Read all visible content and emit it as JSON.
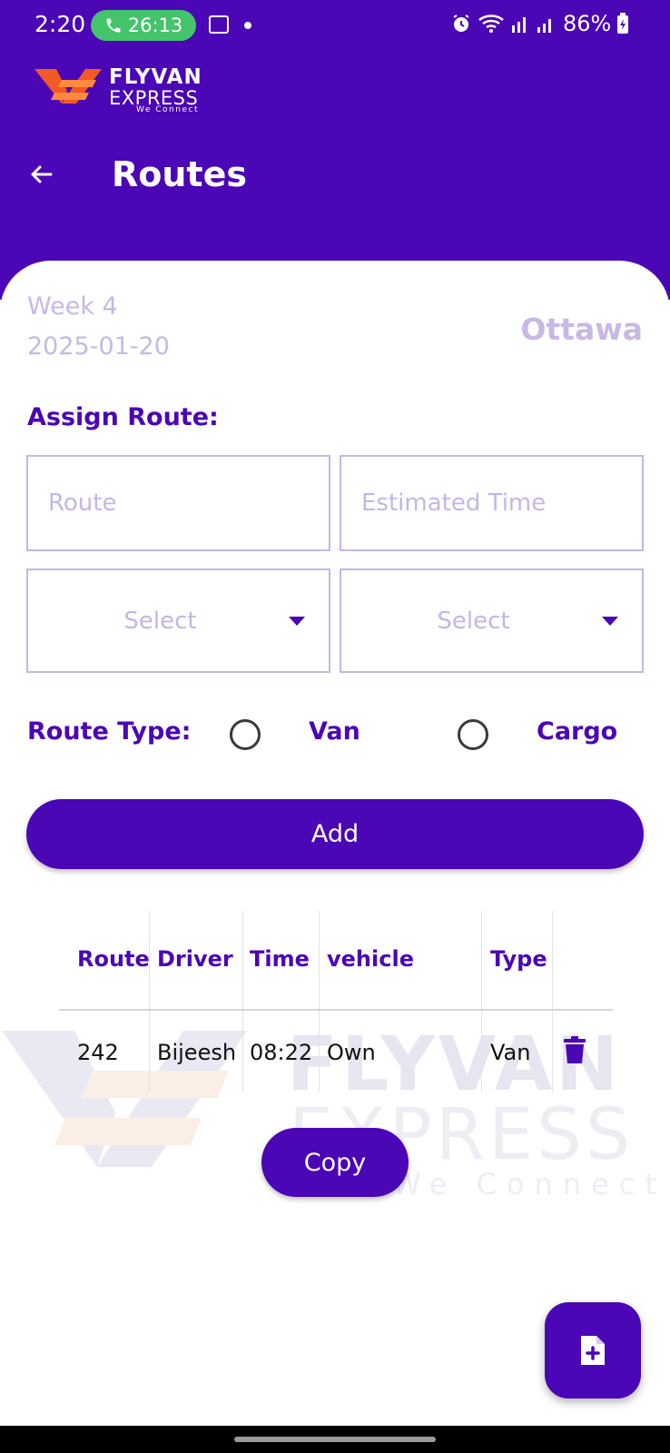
{
  "colors": {
    "primary": "#4b06b5",
    "muted_lavender": "#c8b8e4",
    "call_green": "#45c46b",
    "logo_orange": "#f15a24"
  },
  "status_bar": {
    "time": "2:20",
    "call_timer": "26:13",
    "battery": "86%",
    "icons": [
      "phone-icon",
      "gallery-icon",
      "notification-dot",
      "alarm-icon",
      "wifi-icon",
      "signal-icon",
      "signal-icon",
      "battery-charging-icon"
    ]
  },
  "logo": {
    "title": "FLYVAN",
    "subtitle": "EXPRESS",
    "tagline": "We Connect"
  },
  "header": {
    "title": "Routes",
    "back_icon": "arrow-left-icon"
  },
  "info": {
    "week": "Week 4",
    "date": "2025-01-20",
    "city": "Ottawa"
  },
  "form": {
    "assign_label": "Assign Route:",
    "route_placeholder": "Route",
    "route_value": "",
    "time_placeholder": "Estimated Time",
    "time_value": "",
    "driver_select": "Select",
    "vehicle_select": "Select",
    "route_type_label": "Route Type:",
    "route_types": [
      "Van",
      "Cargo"
    ],
    "add_label": "Add"
  },
  "table": {
    "headers": [
      "Route",
      "Driver",
      "Time",
      "vehicle",
      "Type"
    ],
    "rows": [
      {
        "route": "242",
        "driver": "Bijeesh",
        "time": "08:22",
        "vehicle": "Own",
        "type": "Van",
        "action_icon": "trash-icon"
      }
    ]
  },
  "copy_label": "Copy",
  "fab_icon": "add-document-icon"
}
